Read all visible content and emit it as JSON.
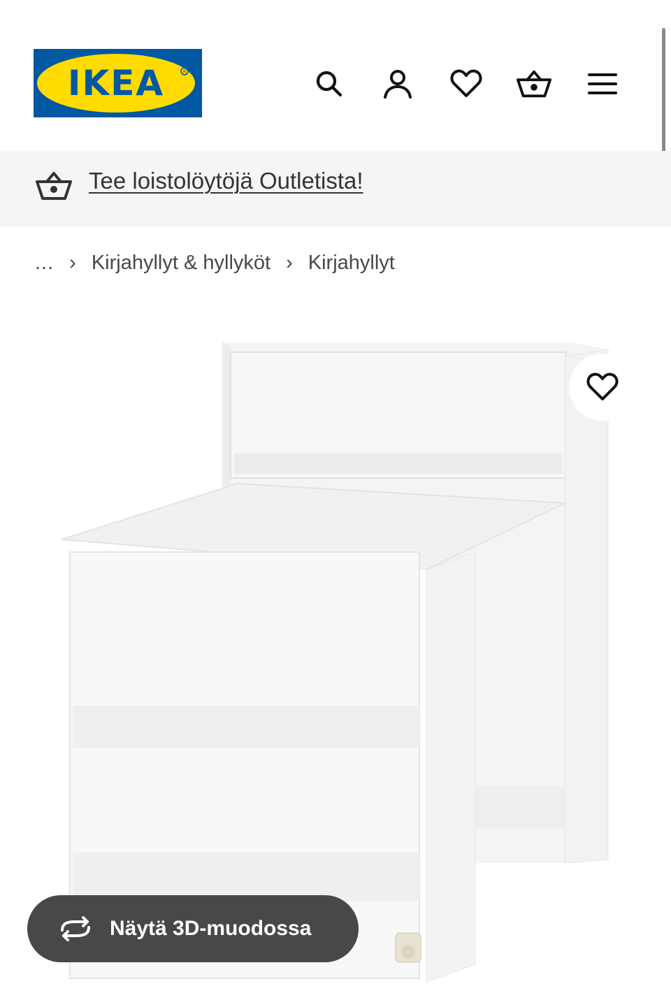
{
  "header": {
    "logo_text": "IKEA",
    "icons": [
      "search-icon",
      "account-icon",
      "heart-icon",
      "basket-icon",
      "menu-icon"
    ]
  },
  "promo": {
    "link_text": "Tee loistolöytöjä Outletista!",
    "icon": "basket-icon"
  },
  "breadcrumb": {
    "ellipsis": "...",
    "items": [
      "Kirjahyllyt & hyllyköt",
      "Kirjahyllyt"
    ],
    "separator": "›"
  },
  "product": {
    "image_alt": "white bookcase desk",
    "favourite_icon": "heart-icon"
  },
  "view3d": {
    "label": "Näytä 3D-muodossa",
    "icon": "rotate-icon"
  },
  "colors": {
    "brand_blue": "#0058a3",
    "brand_yellow": "#ffdb00",
    "promo_bg": "#f5f5f5",
    "pill_bg": "#484848"
  }
}
